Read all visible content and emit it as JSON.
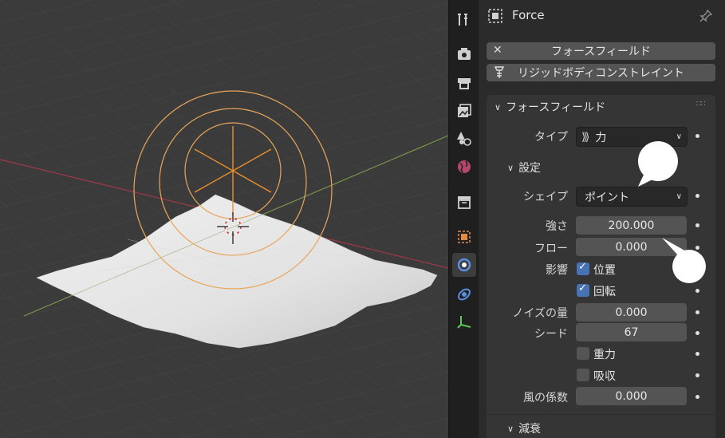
{
  "properties": {
    "object_name": "Force",
    "buttons": {
      "force_field": "フォースフィールド",
      "rigid_body_constraint": "リジッドボディコンストレイント"
    },
    "panel_title": "フォースフィールド",
    "type_label": "タイプ",
    "type_value": "力",
    "settings_section": "設定",
    "shape_label": "シェイプ",
    "shape_value": "ポイント",
    "strength_label": "強さ",
    "strength_value": "200.000",
    "flow_label": "フロー",
    "flow_value": "0.000",
    "affect_label": "影響",
    "affect_location": "位置",
    "affect_rotation": "回転",
    "noise_label": "ノイズの量",
    "noise_value": "0.000",
    "seed_label": "シード",
    "seed_value": "67",
    "gravity_label": "重力",
    "absorption_label": "吸収",
    "wind_factor_label": "風の係数",
    "wind_factor_value": "0.000",
    "falloff_section": "減衰",
    "checkboxes": {
      "location": true,
      "rotation": true,
      "gravity": false,
      "absorption": false
    }
  },
  "tabs": [
    "tool-icon",
    "render-icon",
    "output-icon",
    "view-layer-icon",
    "scene-icon",
    "world-icon",
    "collection-icon",
    "object-icon",
    "physics-icon",
    "constraints-icon",
    "data-icon"
  ],
  "colors": {
    "accent": "#4772b3",
    "field_empty": "#e8a65a",
    "x_axis": "#a0374a",
    "y_axis": "#6e8c3a"
  }
}
